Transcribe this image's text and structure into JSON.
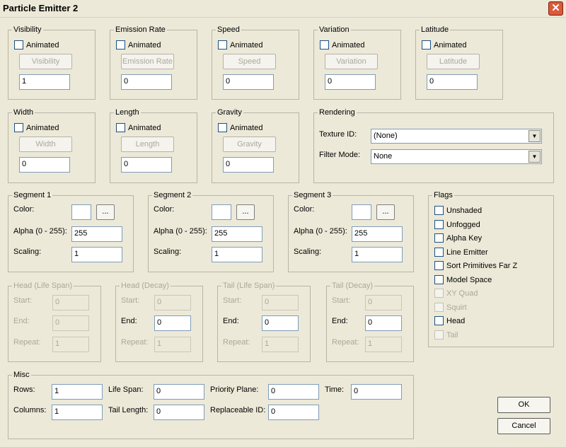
{
  "window": {
    "title": "Particle Emitter 2",
    "close_glyph": "✕"
  },
  "animated_label": "Animated",
  "top_groups": [
    {
      "title": "Visibility",
      "button": "Visibility",
      "value": "1"
    },
    {
      "title": "Emission Rate",
      "button": "Emission Rate",
      "value": "0"
    },
    {
      "title": "Speed",
      "button": "Speed",
      "value": "0"
    },
    {
      "title": "Variation",
      "button": "Variation",
      "value": "0"
    },
    {
      "title": "Latitude",
      "button": "Latitude",
      "value": "0"
    }
  ],
  "mid_groups": [
    {
      "title": "Width",
      "button": "Width",
      "value": "0"
    },
    {
      "title": "Length",
      "button": "Length",
      "value": "0"
    },
    {
      "title": "Gravity",
      "button": "Gravity",
      "value": "0"
    }
  ],
  "rendering": {
    "title": "Rendering",
    "texture_label": "Texture ID:",
    "texture_value": "(None)",
    "filter_label": "Filter Mode:",
    "filter_value": "None"
  },
  "segments": [
    {
      "title": "Segment 1",
      "color_label": "Color:",
      "alpha_label": "Alpha (0 - 255):",
      "alpha": "255",
      "scaling_label": "Scaling:",
      "scaling": "1",
      "browse": "..."
    },
    {
      "title": "Segment 2",
      "color_label": "Color:",
      "alpha_label": "Alpha (0 - 255):",
      "alpha": "255",
      "scaling_label": "Scaling:",
      "scaling": "1",
      "browse": "..."
    },
    {
      "title": "Segment 3",
      "color_label": "Color:",
      "alpha_label": "Alpha (0 - 255):",
      "alpha": "255",
      "scaling_label": "Scaling:",
      "scaling": "1",
      "browse": "..."
    }
  ],
  "flags": {
    "title": "Flags",
    "items": [
      "Unshaded",
      "Unfogged",
      "Alpha Key",
      "Line Emitter",
      "Sort Primitives Far Z",
      "Model Space",
      "XY Quad",
      "Squirt",
      "Head",
      "Tail"
    ]
  },
  "span_groups": [
    {
      "title": "Head (Life Span)",
      "start_label": "Start:",
      "start": "0",
      "end_label": "End:",
      "end": "0",
      "repeat_label": "Repeat:",
      "repeat": "1"
    },
    {
      "title": "Head (Decay)",
      "start_label": "Start:",
      "start": "0",
      "end_label": "End:",
      "end": "0",
      "repeat_label": "Repeat:",
      "repeat": "1"
    },
    {
      "title": "Tail (Life Span)",
      "start_label": "Start:",
      "start": "0",
      "end_label": "End:",
      "end": "0",
      "repeat_label": "Repeat:",
      "repeat": "1"
    },
    {
      "title": "Tail (Decay)",
      "start_label": "Start:",
      "start": "0",
      "end_label": "End:",
      "end": "0",
      "repeat_label": "Repeat:",
      "repeat": "1"
    }
  ],
  "misc": {
    "title": "Misc",
    "rows_label": "Rows:",
    "rows": "1",
    "columns_label": "Columns:",
    "columns": "1",
    "life_span_label": "Life Span:",
    "life_span": "0",
    "tail_length_label": "Tail Length:",
    "tail_length": "0",
    "priority_label": "Priority Plane:",
    "priority": "0",
    "replaceable_label": "Replaceable ID:",
    "replaceable": "0",
    "time_label": "Time:",
    "time": "0"
  },
  "ok_label": "OK",
  "cancel_label": "Cancel"
}
